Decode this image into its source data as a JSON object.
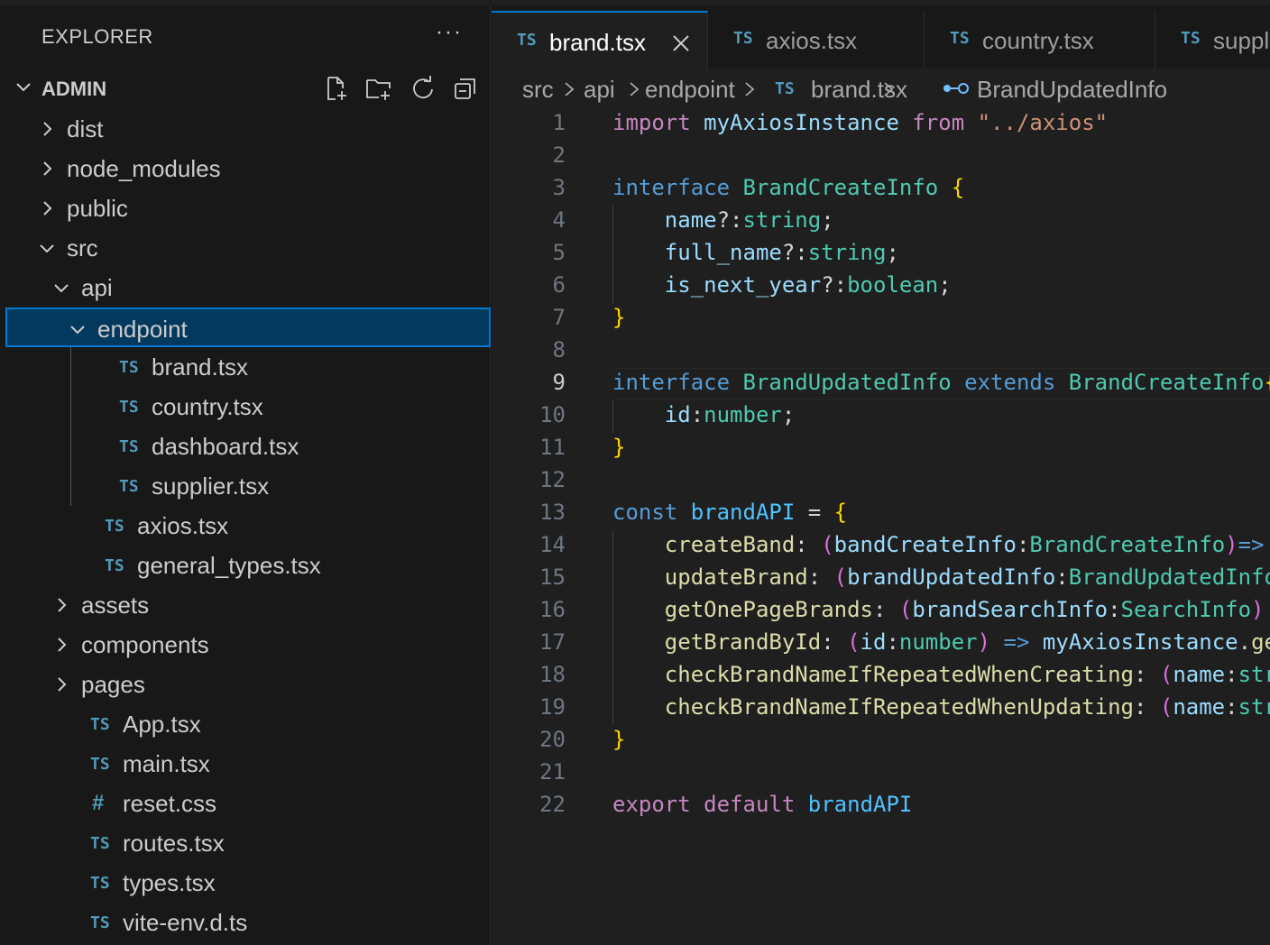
{
  "explorer": {
    "title": "EXPLORER",
    "more": "···",
    "section": "ADMIN",
    "tree": [
      {
        "label": "dist",
        "kind": "folder",
        "open": false,
        "indent": 0
      },
      {
        "label": "node_modules",
        "kind": "folder",
        "open": false,
        "indent": 0
      },
      {
        "label": "public",
        "kind": "folder",
        "open": false,
        "indent": 0
      },
      {
        "label": "src",
        "kind": "folder",
        "open": true,
        "indent": 0
      },
      {
        "label": "api",
        "kind": "folder",
        "open": true,
        "indent": 1
      },
      {
        "label": "endpoint",
        "kind": "folder",
        "open": true,
        "indent": 2,
        "selected": true
      },
      {
        "label": "brand.tsx",
        "kind": "ts",
        "indent": 3
      },
      {
        "label": "country.tsx",
        "kind": "ts",
        "indent": 3
      },
      {
        "label": "dashboard.tsx",
        "kind": "ts",
        "indent": 3
      },
      {
        "label": "supplier.tsx",
        "kind": "ts",
        "indent": 3
      },
      {
        "label": "axios.tsx",
        "kind": "ts",
        "indent": 2
      },
      {
        "label": "general_types.tsx",
        "kind": "ts",
        "indent": 2
      },
      {
        "label": "assets",
        "kind": "folder",
        "open": false,
        "indent": 1
      },
      {
        "label": "components",
        "kind": "folder",
        "open": false,
        "indent": 1
      },
      {
        "label": "pages",
        "kind": "folder",
        "open": false,
        "indent": 1
      },
      {
        "label": "App.tsx",
        "kind": "ts",
        "indent": 1
      },
      {
        "label": "main.tsx",
        "kind": "ts",
        "indent": 1
      },
      {
        "label": "reset.css",
        "kind": "css",
        "indent": 1
      },
      {
        "label": "routes.tsx",
        "kind": "ts",
        "indent": 1
      },
      {
        "label": "types.tsx",
        "kind": "ts",
        "indent": 1
      },
      {
        "label": "vite-env.d.ts",
        "kind": "ts",
        "indent": 1
      }
    ]
  },
  "ts_badge": "TS",
  "css_badge": "#",
  "tabs": [
    {
      "name": "brand.tsx",
      "active": true
    },
    {
      "name": "axios.tsx",
      "active": false
    },
    {
      "name": "country.tsx",
      "active": false
    },
    {
      "name": "supplier.tsx",
      "active": false
    }
  ],
  "breadcrumb": [
    "src",
    "api",
    "endpoint",
    "brand.tsx",
    "BrandUpdatedInfo"
  ],
  "editor": {
    "current_line": 9,
    "lines": [
      [
        [
          "k-ctl",
          "import"
        ],
        [
          "",
          "",
          " "
        ],
        [
          "k-var",
          "myAxiosInstance"
        ],
        [
          "",
          " "
        ],
        [
          "k-ctl",
          "from"
        ],
        [
          "",
          " "
        ],
        [
          "k-str",
          "\"../axios\""
        ]
      ],
      [],
      [
        [
          "k-kw",
          "interface"
        ],
        [
          "",
          " "
        ],
        [
          "k-type",
          "BrandCreateInfo"
        ],
        [
          "",
          " "
        ],
        [
          "k-br",
          "{"
        ]
      ],
      [
        [
          "",
          "    "
        ],
        [
          "k-var",
          "name"
        ],
        [
          "k-op",
          "?:"
        ],
        [
          "k-type",
          "string"
        ],
        [
          "k-op",
          ";"
        ]
      ],
      [
        [
          "",
          "    "
        ],
        [
          "k-var",
          "full_name"
        ],
        [
          "k-op",
          "?:"
        ],
        [
          "k-type",
          "string"
        ],
        [
          "k-op",
          ";"
        ]
      ],
      [
        [
          "",
          "    "
        ],
        [
          "k-var",
          "is_next_year"
        ],
        [
          "k-op",
          "?:"
        ],
        [
          "k-type",
          "boolean"
        ],
        [
          "k-op",
          ";"
        ]
      ],
      [
        [
          "k-br",
          "}"
        ]
      ],
      [],
      [
        [
          "k-kw",
          "interface"
        ],
        [
          "",
          " "
        ],
        [
          "k-type",
          "BrandUpdatedInfo"
        ],
        [
          "",
          " "
        ],
        [
          "k-kw",
          "extends"
        ],
        [
          "",
          " "
        ],
        [
          "k-type",
          "BrandCreateInfo"
        ],
        [
          "k-br",
          "{"
        ]
      ],
      [
        [
          "",
          "    "
        ],
        [
          "k-var",
          "id"
        ],
        [
          "k-op",
          ":"
        ],
        [
          "k-type",
          "number"
        ],
        [
          "k-op",
          ";"
        ]
      ],
      [
        [
          "k-br",
          "}"
        ]
      ],
      [],
      [
        [
          "k-kw",
          "const"
        ],
        [
          "",
          " "
        ],
        [
          "k-const",
          "brandAPI"
        ],
        [
          "",
          " "
        ],
        [
          "k-op",
          "="
        ],
        [
          "",
          " "
        ],
        [
          "k-br",
          "{"
        ]
      ],
      [
        [
          "",
          "    "
        ],
        [
          "k-fn",
          "createBand"
        ],
        [
          "k-op",
          ":"
        ],
        [
          "",
          " "
        ],
        [
          "k-br2",
          "("
        ],
        [
          "k-var",
          "bandCreateInfo"
        ],
        [
          "k-op",
          ":"
        ],
        [
          "k-type",
          "BrandCreateInfo"
        ],
        [
          "k-br2",
          ")"
        ],
        [
          "k-kw",
          "=>"
        ]
      ],
      [
        [
          "",
          "    "
        ],
        [
          "k-fn",
          "updateBrand"
        ],
        [
          "k-op",
          ":"
        ],
        [
          "",
          " "
        ],
        [
          "k-br2",
          "("
        ],
        [
          "k-var",
          "brandUpdatedInfo"
        ],
        [
          "k-op",
          ":"
        ],
        [
          "k-type",
          "BrandUpdatedInfo"
        ]
      ],
      [
        [
          "",
          "    "
        ],
        [
          "k-fn",
          "getOnePageBrands"
        ],
        [
          "k-op",
          ":"
        ],
        [
          "",
          " "
        ],
        [
          "k-br2",
          "("
        ],
        [
          "k-var",
          "brandSearchInfo"
        ],
        [
          "k-op",
          ":"
        ],
        [
          "k-type",
          "SearchInfo"
        ],
        [
          "k-br2",
          ")"
        ]
      ],
      [
        [
          "",
          "    "
        ],
        [
          "k-fn",
          "getBrandById"
        ],
        [
          "k-op",
          ":"
        ],
        [
          "",
          " "
        ],
        [
          "k-br2",
          "("
        ],
        [
          "k-var",
          "id"
        ],
        [
          "k-op",
          ":"
        ],
        [
          "k-type",
          "number"
        ],
        [
          "k-br2",
          ")"
        ],
        [
          "",
          " "
        ],
        [
          "k-kw",
          "=>"
        ],
        [
          "",
          " "
        ],
        [
          "k-var",
          "myAxiosInstance"
        ],
        [
          "k-op",
          "."
        ],
        [
          "k-fn",
          "get"
        ]
      ],
      [
        [
          "",
          "    "
        ],
        [
          "k-fn",
          "checkBrandNameIfRepeatedWhenCreating"
        ],
        [
          "k-op",
          ":"
        ],
        [
          "",
          " "
        ],
        [
          "k-br2",
          "("
        ],
        [
          "k-var",
          "name"
        ],
        [
          "k-op",
          ":"
        ],
        [
          "k-type",
          "string"
        ]
      ],
      [
        [
          "",
          "    "
        ],
        [
          "k-fn",
          "checkBrandNameIfRepeatedWhenUpdating"
        ],
        [
          "k-op",
          ":"
        ],
        [
          "",
          " "
        ],
        [
          "k-br2",
          "("
        ],
        [
          "k-var",
          "name"
        ],
        [
          "k-op",
          ":"
        ],
        [
          "k-type",
          "string"
        ]
      ],
      [
        [
          "k-br",
          "}"
        ]
      ],
      [],
      [
        [
          "k-ctl",
          "export"
        ],
        [
          "",
          " "
        ],
        [
          "k-ctl",
          "default"
        ],
        [
          "",
          " "
        ],
        [
          "k-const",
          "brandAPI"
        ]
      ]
    ]
  }
}
